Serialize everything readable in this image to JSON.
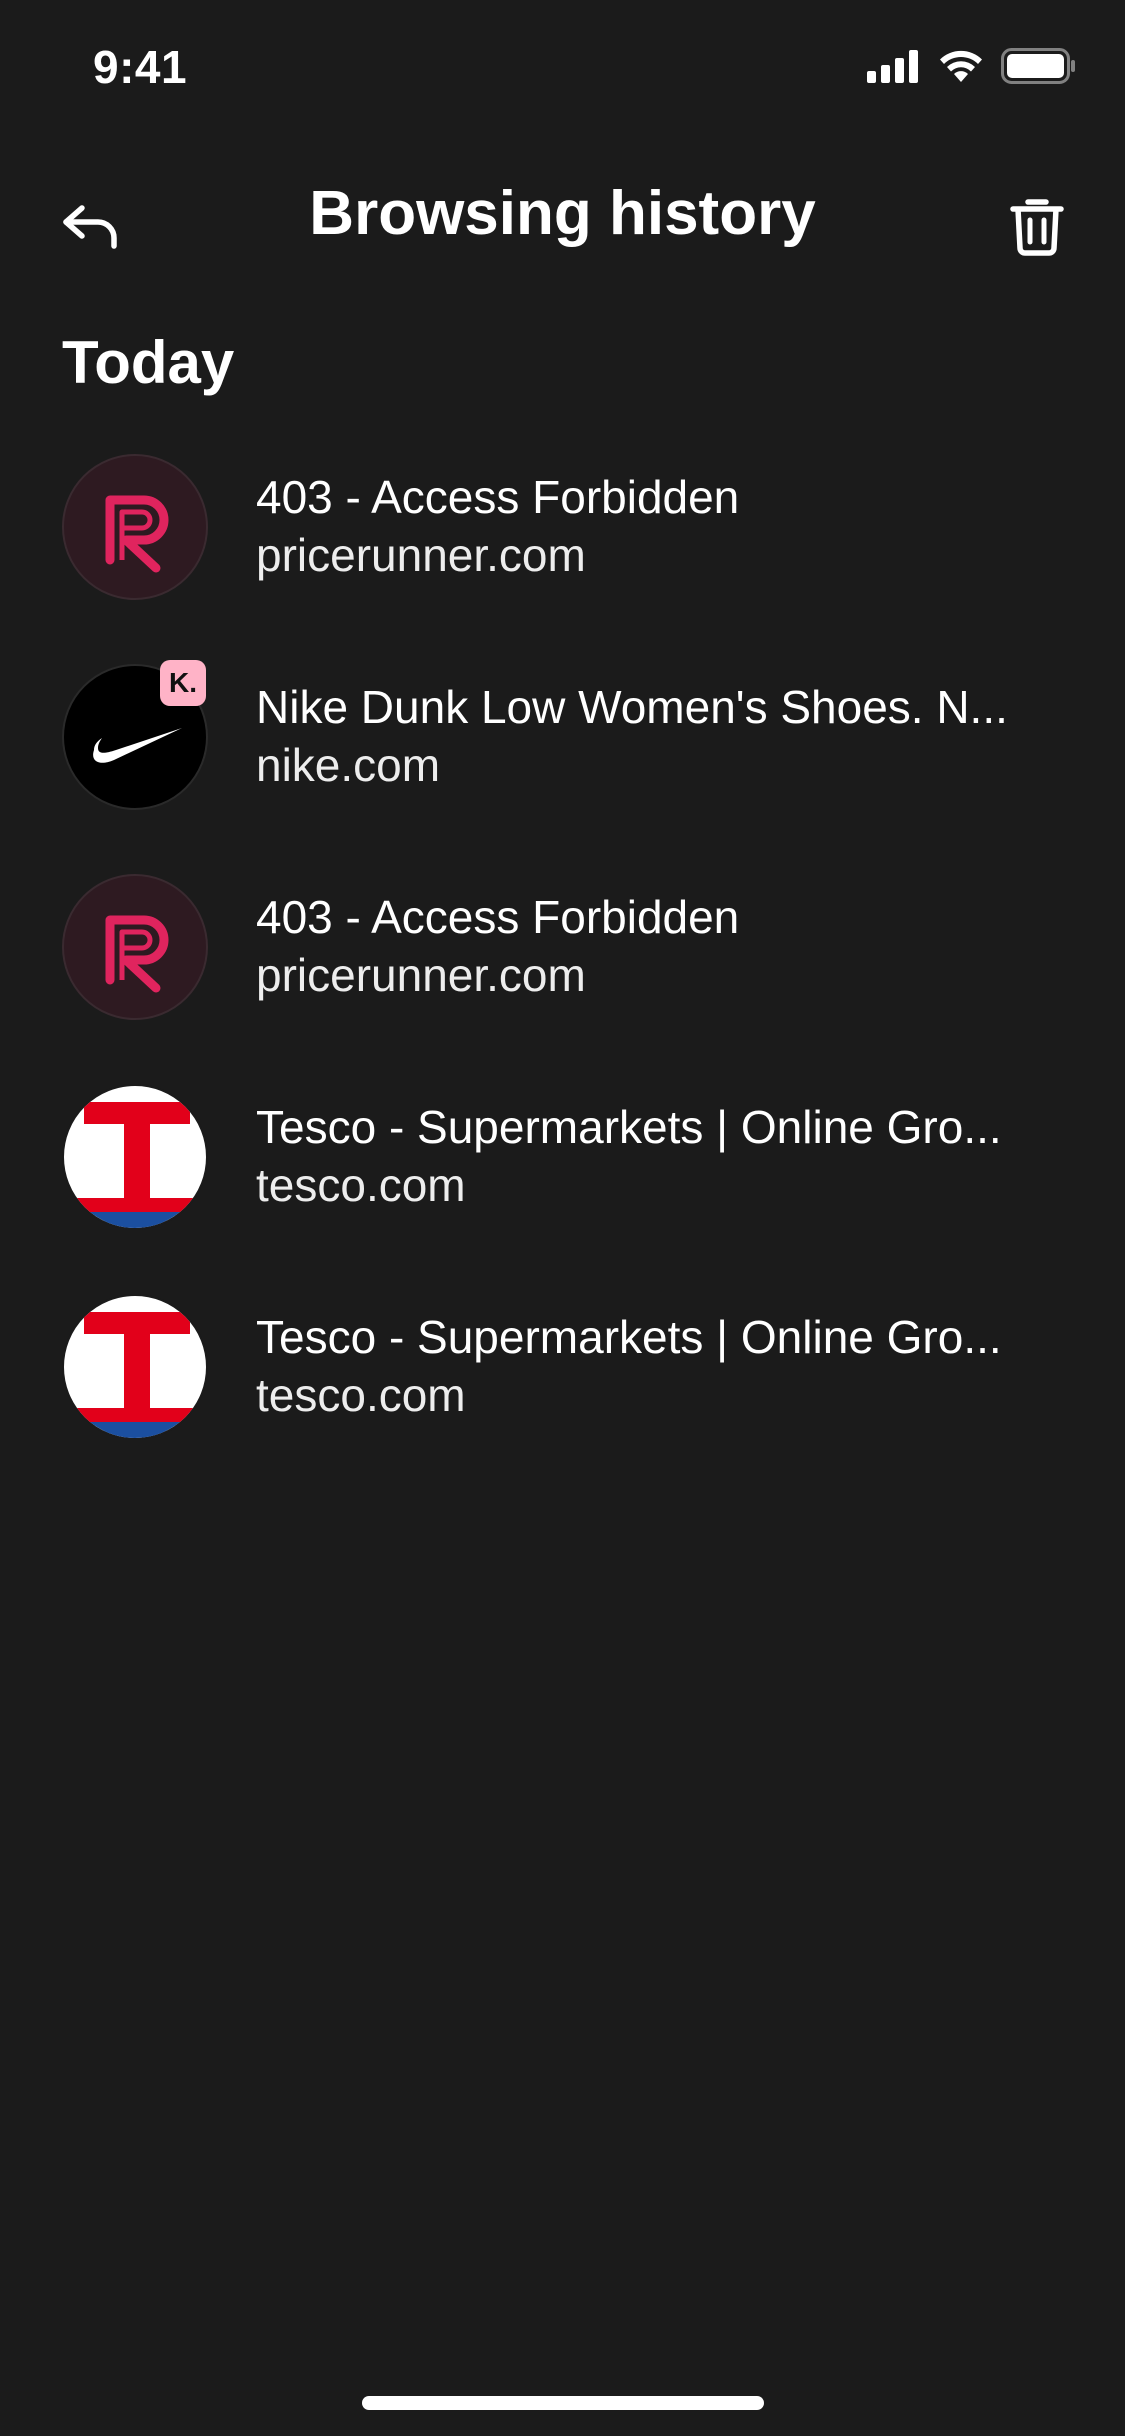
{
  "status_bar": {
    "time": "9:41"
  },
  "header": {
    "title": "Browsing history",
    "back_icon": "back-arrow-icon",
    "trash_icon": "trash-icon"
  },
  "section": {
    "title": "Today"
  },
  "history": [
    {
      "title": "403 - Access Forbidden",
      "domain": "pricerunner.com",
      "icon": "pricerunner-logo-icon"
    },
    {
      "title": "Nike Dunk Low Women's Shoes. N...",
      "domain": "nike.com",
      "icon": "nike-swoosh-icon",
      "badge": "K."
    },
    {
      "title": "403 - Access Forbidden",
      "domain": "pricerunner.com",
      "icon": "pricerunner-logo-icon"
    },
    {
      "title": "Tesco - Supermarkets | Online Gro...",
      "domain": "tesco.com",
      "icon": "tesco-logo-icon"
    },
    {
      "title": "Tesco - Supermarkets | Online Gro...",
      "domain": "tesco.com",
      "icon": "tesco-logo-icon"
    }
  ],
  "colors": {
    "background": "#1b1b1b",
    "pricerunner_bg": "#2e1a21",
    "pricerunner_accent": "#e0245e",
    "klarna_pink": "#ffb3c7",
    "tesco_red": "#e2001a",
    "tesco_blue": "#1b4fa0"
  }
}
